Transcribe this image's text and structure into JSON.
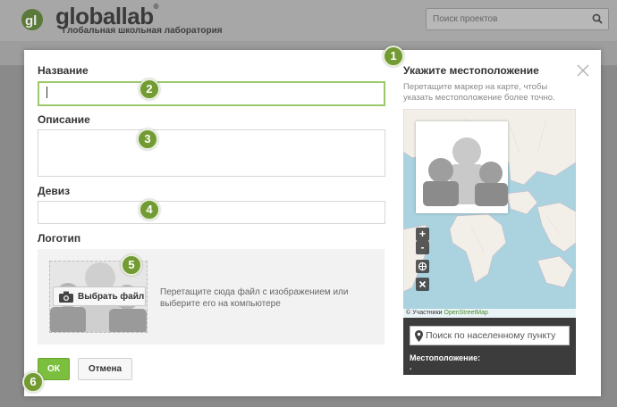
{
  "header": {
    "logo_text": "globallab",
    "logo_mark": "®",
    "tagline": "Глобальная школьная лаборатория",
    "search_placeholder": "Поиск проектов"
  },
  "form": {
    "name_label": "Название",
    "name_value": "",
    "description_label": "Описание",
    "description_value": "",
    "motto_label": "Девиз",
    "motto_value": "",
    "logo_label": "Логотип",
    "choose_file_label": "Выбрать файл",
    "drop_hint": "Перетащите сюда файл с изображением или выберите его на компьютере",
    "ok_label": "ОК",
    "cancel_label": "Отмена"
  },
  "location": {
    "title": "Укажите местоположение",
    "hint": "Перетащите маркер на карте, чтобы указать местоположение более точно.",
    "zoom_in": "+",
    "zoom_out": "-",
    "attribution_prefix": "© Участники",
    "attribution_link": "OpenStreetMap",
    "search_placeholder": "Поиск по населенному пункту",
    "location_label": "Местоположение:",
    "location_value": "."
  },
  "badges": [
    "1",
    "2",
    "3",
    "4",
    "5",
    "6"
  ],
  "colors": {
    "accent_green": "#7cbf3f",
    "badge_green": "#739b34",
    "map_water": "#aad3df",
    "map_land": "#f2efe9"
  },
  "icons": [
    "search-icon",
    "close-icon",
    "camera-icon",
    "map-pin-icon",
    "globe-icon",
    "clear-icon"
  ]
}
